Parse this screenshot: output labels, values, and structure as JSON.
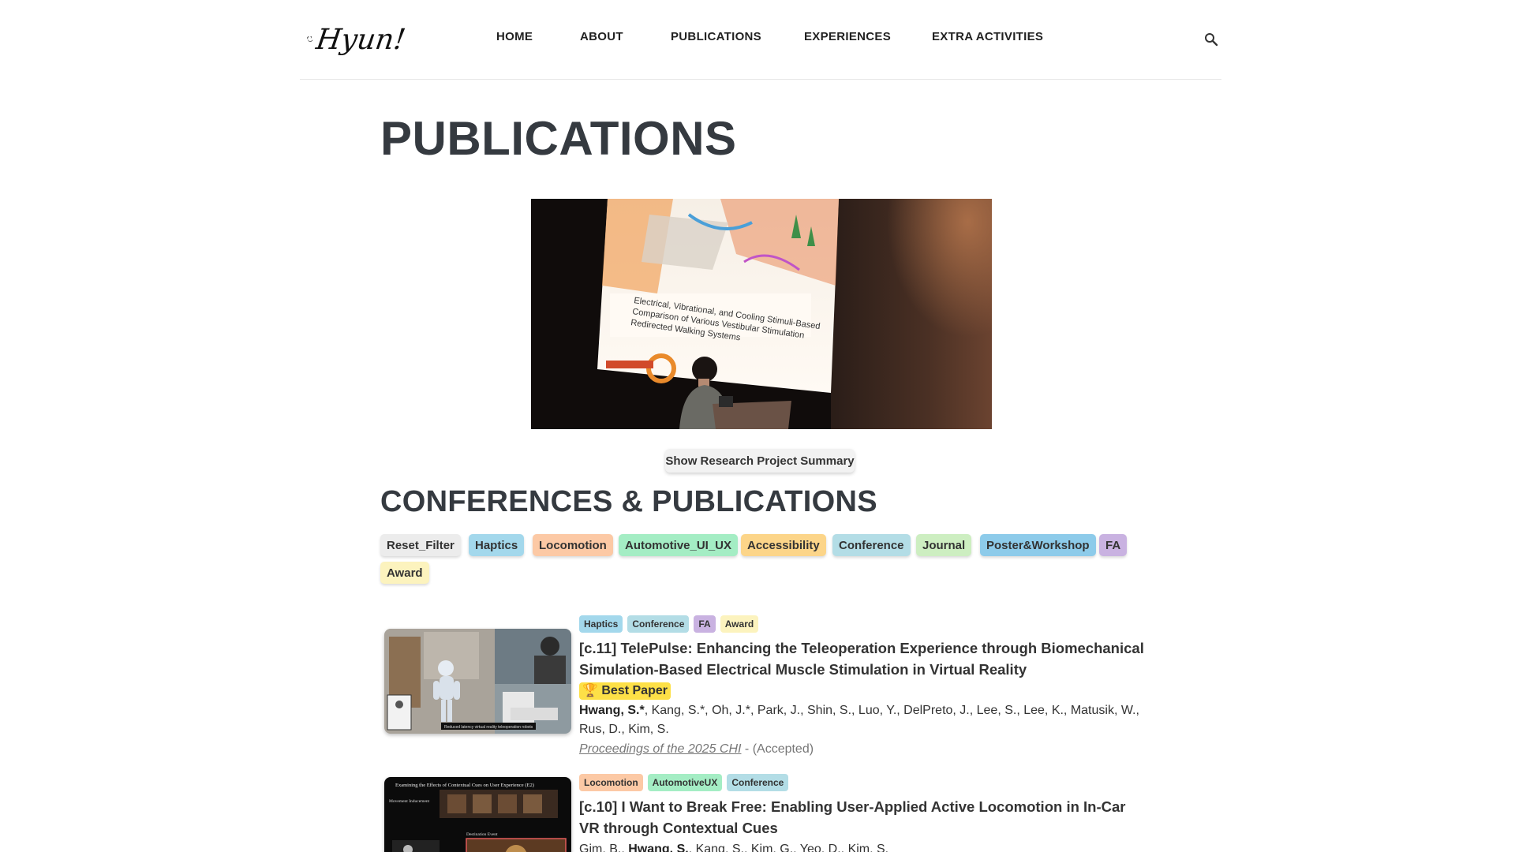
{
  "header": {
    "logo_text": "Hyun!",
    "nav": [
      {
        "label": "HOME"
      },
      {
        "label": "ABOUT"
      },
      {
        "label": "PUBLICATIONS"
      },
      {
        "label": "EXPERIENCES"
      },
      {
        "label": "EXTRA ACTIVITIES"
      }
    ],
    "search_icon": "search-icon"
  },
  "page_title": "PUBLICATIONS",
  "hero": {
    "slide_text": "Electrical, Vibrational, and Cooling Stimuli-Based Redirected Walking: Comparison of Various Vestibular Stimulation-Based Redirected Walking Systems"
  },
  "summary_button": "Show Research Project Summary",
  "section_title": "CONFERENCES & PUBLICATIONS",
  "filters": [
    {
      "label": "Reset_Filter",
      "color": "#ececec"
    },
    {
      "label": "Haptics",
      "color": "#a3d8ec"
    },
    {
      "label": "Locomotion",
      "color": "#fcc9a5"
    },
    {
      "label": "Automotive_UI_UX",
      "color": "#a4edc4"
    },
    {
      "label": "Accessibility",
      "color": "#fcd589"
    },
    {
      "label": "Conference",
      "color": "#b3dde6"
    },
    {
      "label": "Journal",
      "color": "#cdeec1"
    },
    {
      "label": "Poster&Workshop",
      "color": "#8dcbea"
    },
    {
      "label": "FA",
      "color": "#c9b2e1"
    },
    {
      "label": "Award",
      "color": "#fcf3be"
    }
  ],
  "publications": [
    {
      "tags": [
        "Haptics",
        "Conference",
        "FA",
        "Award"
      ],
      "title": "[c.11] TelePulse: Enhancing the Teleoperation Experience through Biomechanical Simulation-Based Electrical Muscle Stimulation in Virtual Reality",
      "award": "🏆 Best Paper",
      "authors_lead": "Hwang, S.*",
      "authors_rest": ", Kang, S.*, Oh, J.*, Park, J., Shin, S., Luo, Y., DelPreto, J., Lee, S., Lee, K., Matusik, W., Rus, D., Kim, S.",
      "venue": "Proceedings of the 2025 CHI",
      "status": " - (Accepted)",
      "thumb_caption": "Reduced latency virtual reality teleoperation robots"
    },
    {
      "tags": [
        "Locomotion",
        "AutomotiveUX",
        "Conference"
      ],
      "title": "[c.10] I Want to Break Free: Enabling User-Applied Active Locomotion in In-Car VR through Contextual Cues",
      "authors_pre": "Gim, B., ",
      "authors_lead": "Hwang, S.",
      "authors_rest": ", Kang, S., Kim, G., Yeo, D., Kim, S.",
      "thumb_caption": "Examining the Effects of Contextual Cues on User Experience (E2)",
      "thumb_label_1": "Movement Inducement",
      "thumb_label_2": "Destination Event"
    }
  ]
}
